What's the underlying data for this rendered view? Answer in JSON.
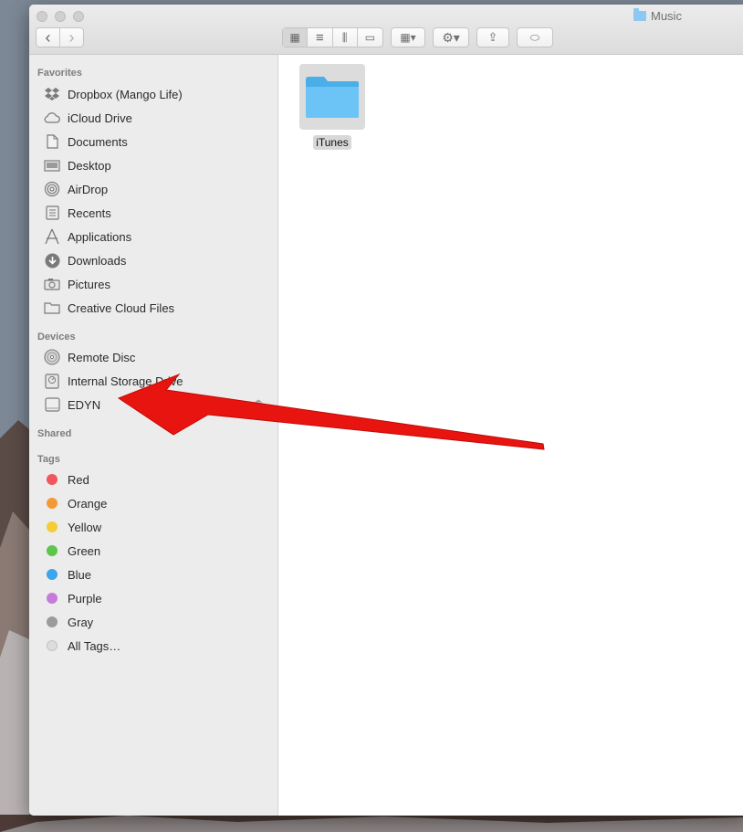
{
  "window": {
    "title": "Music"
  },
  "toolbar": {
    "back": "‹",
    "forward": "›",
    "view_icons": "▦",
    "view_list": "≡",
    "view_columns": "⫼",
    "view_coverflow": "▭",
    "arrange": "▦▾",
    "action": "⚙▾",
    "share": "⇪",
    "tag": "⬭"
  },
  "sidebar": {
    "favorites_title": "Favorites",
    "favorites": [
      {
        "label": "Dropbox (Mango Life)",
        "icon": "dropbox-icon"
      },
      {
        "label": "iCloud Drive",
        "icon": "cloud-icon"
      },
      {
        "label": "Documents",
        "icon": "document-icon"
      },
      {
        "label": "Desktop",
        "icon": "desktop-icon"
      },
      {
        "label": "AirDrop",
        "icon": "airdrop-icon"
      },
      {
        "label": "Recents",
        "icon": "recents-icon"
      },
      {
        "label": "Applications",
        "icon": "applications-icon"
      },
      {
        "label": "Downloads",
        "icon": "downloads-icon"
      },
      {
        "label": "Pictures",
        "icon": "camera-icon"
      },
      {
        "label": "Creative Cloud Files",
        "icon": "folder-icon"
      }
    ],
    "devices_title": "Devices",
    "devices": [
      {
        "label": "Remote Disc",
        "icon": "disc-icon"
      },
      {
        "label": "Internal Storage Drive",
        "icon": "hard-drive-icon"
      },
      {
        "label": "EDYN",
        "icon": "external-drive-icon"
      }
    ],
    "eject": "⏏",
    "shared_title": "Shared",
    "tags_title": "Tags",
    "tags": [
      {
        "label": "Red",
        "color": "#f0575a"
      },
      {
        "label": "Orange",
        "color": "#f39a35"
      },
      {
        "label": "Yellow",
        "color": "#f5cc35"
      },
      {
        "label": "Green",
        "color": "#5cc54a"
      },
      {
        "label": "Blue",
        "color": "#3ea4ec"
      },
      {
        "label": "Purple",
        "color": "#c77bd9"
      },
      {
        "label": "Gray",
        "color": "#9b9b9b"
      },
      {
        "label": "All Tags…",
        "color": "#dcdcdc"
      }
    ]
  },
  "content": {
    "items": [
      {
        "label": "iTunes",
        "icon": "folder-icon"
      }
    ]
  },
  "annotation": {
    "color": "#e8140f"
  }
}
